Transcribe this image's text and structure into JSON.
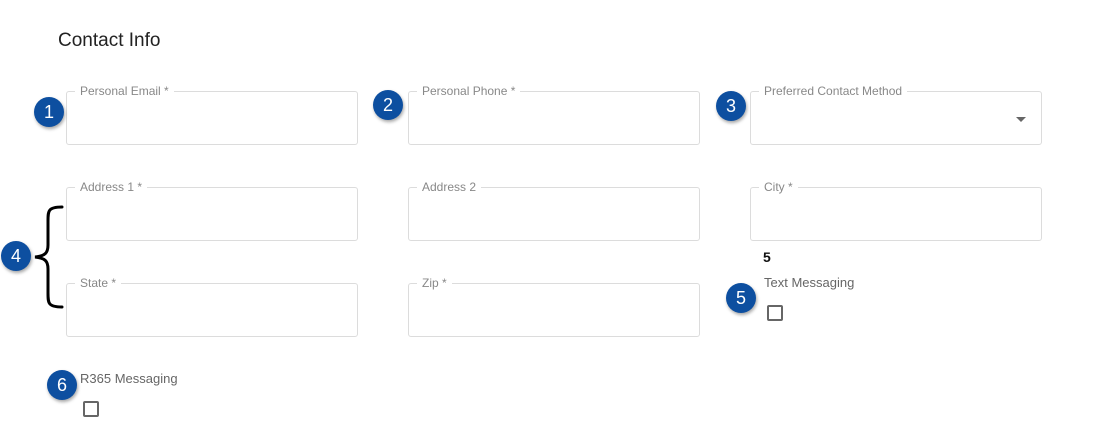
{
  "section": {
    "title": "Contact Info"
  },
  "fields": {
    "personal_email": {
      "label": "Personal Email *",
      "value": ""
    },
    "personal_phone": {
      "label": "Personal Phone *",
      "value": ""
    },
    "preferred_contact": {
      "label": "Preferred Contact Method",
      "value": ""
    },
    "address1": {
      "label": "Address 1 *",
      "value": ""
    },
    "address2": {
      "label": "Address 2",
      "value": ""
    },
    "city": {
      "label": "City *",
      "value": ""
    },
    "state": {
      "label": "State *",
      "value": ""
    },
    "zip": {
      "label": "Zip *",
      "value": ""
    }
  },
  "checkboxes": {
    "text_messaging": {
      "label": "Text Messaging",
      "checked": false
    },
    "r365_messaging": {
      "label": "R365 Messaging",
      "checked": false
    }
  },
  "annotations": {
    "badges": [
      "1",
      "2",
      "3",
      "4",
      "5",
      "6"
    ],
    "marker_5": "5"
  },
  "colors": {
    "badge": "#0d4fa0",
    "field_border": "#dcdcdc"
  }
}
